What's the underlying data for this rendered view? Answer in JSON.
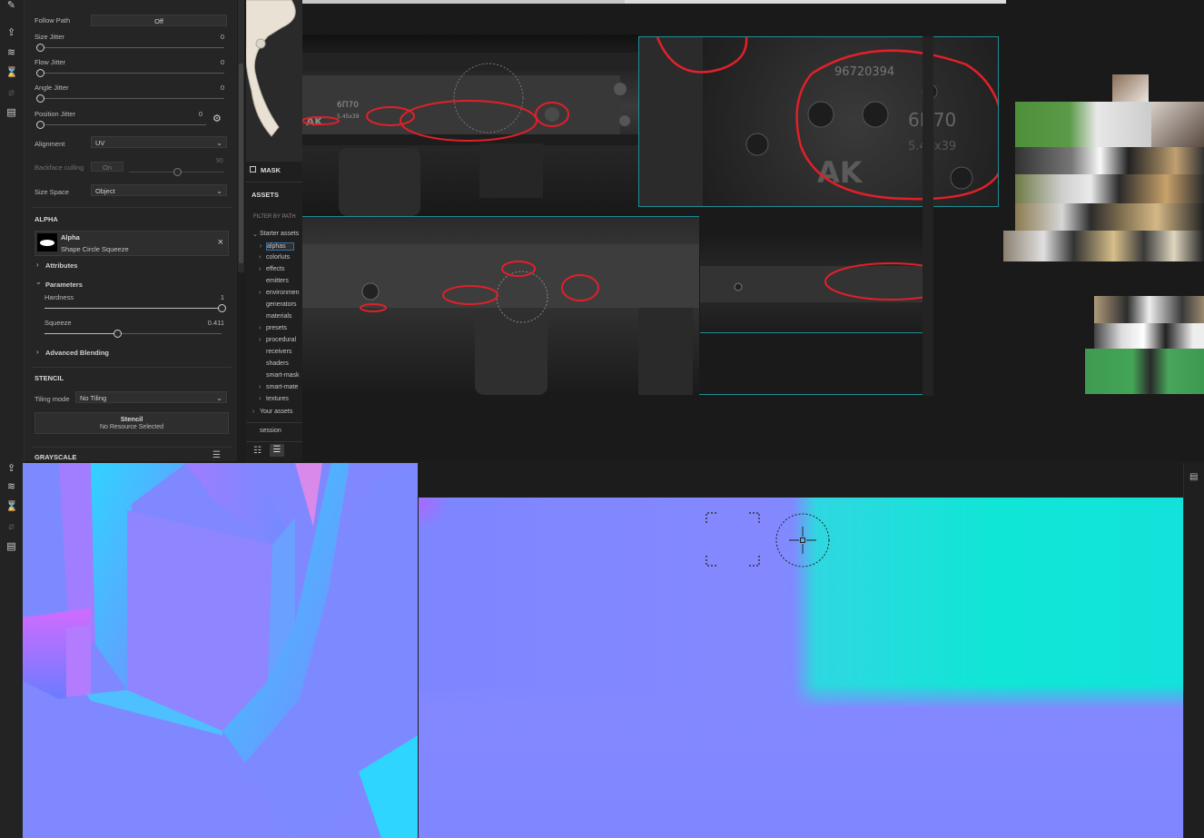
{
  "props": {
    "follow_path": {
      "label": "Follow Path",
      "value": "Off"
    },
    "size_jitter": {
      "label": "Size Jitter",
      "value": "0"
    },
    "flow_jitter": {
      "label": "Flow Jitter",
      "value": "0"
    },
    "angle_jitter": {
      "label": "Angle Jitter",
      "value": "0"
    },
    "position_jitter": {
      "label": "Position Jitter",
      "value": "0"
    },
    "alignment": {
      "label": "Alignment",
      "value": "UV"
    },
    "backface_culling": {
      "label": "Backface culling",
      "value": "On",
      "angle": "90"
    },
    "size_space": {
      "label": "Size Space",
      "value": "Object"
    }
  },
  "alpha": {
    "section_title": "ALPHA",
    "name": "Alpha",
    "resource": "Shape Circle Squeeze",
    "close_symbol": "×",
    "attributes_label": "Attributes",
    "parameters_label": "Parameters",
    "hardness": {
      "label": "Hardness",
      "value": "1",
      "level": 1.0
    },
    "squeeze": {
      "label": "Squeeze",
      "value": "0.411",
      "level": 0.411
    },
    "advanced_label": "Advanced Blending"
  },
  "stencil": {
    "section_title": "STENCIL",
    "tiling_label": "Tiling mode",
    "tiling_value": "No Tiling",
    "slot_title": "Stencil",
    "slot_sub": "No Resource Selected"
  },
  "grayscale": {
    "section_title": "GRAYSCALE"
  },
  "assets_panel": {
    "mask_label": "MASK",
    "assets_title": "ASSETS",
    "filter_label": "FILTER BY PATH",
    "root": "Starter assets",
    "items": [
      "alphas",
      "colorluts",
      "effects",
      "emitters",
      "environmen",
      "generators",
      "materials",
      "presets",
      "procedural",
      "receivers",
      "shaders",
      "smart-mask",
      "smart-mate",
      "textures"
    ],
    "your_assets": "Your assets",
    "session": "session"
  },
  "board_text": {
    "serial": "96720394",
    "model": "6П70",
    "caliber": "5.45x39",
    "logo": "AK"
  },
  "icons": {
    "brush": "brush-icon",
    "export": "export-icon",
    "layers": "layers-icon",
    "eraser": "eraser-icon",
    "document": "document-icon",
    "settings": "gear-icon",
    "menu": "menu-lines-icon"
  },
  "colors": {
    "normal_blue": "#8087ff",
    "normal_cyan": "#14e4d8",
    "annotation_red": "#e0202a",
    "board_outline": "#1f8e96"
  }
}
